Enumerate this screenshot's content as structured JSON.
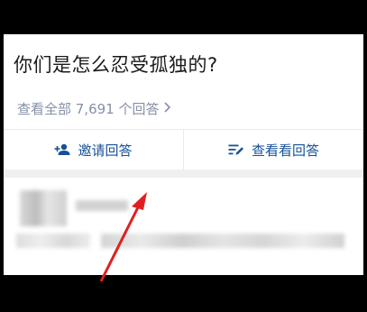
{
  "question": {
    "title": "你们是怎么忍受孤独的?",
    "all_answers_label": "查看全部 7,691 个回答"
  },
  "actions": {
    "invite_label": "邀请回答",
    "view_label": "查看看回答"
  },
  "colors": {
    "title": "#1a1a1a",
    "meta": "#8590a6",
    "action": "#175199",
    "arrow": "#e02020"
  },
  "icons": [
    "invite-user-icon",
    "chevron-right-icon",
    "write-answer-icon",
    "red-arrow-annotation"
  ]
}
